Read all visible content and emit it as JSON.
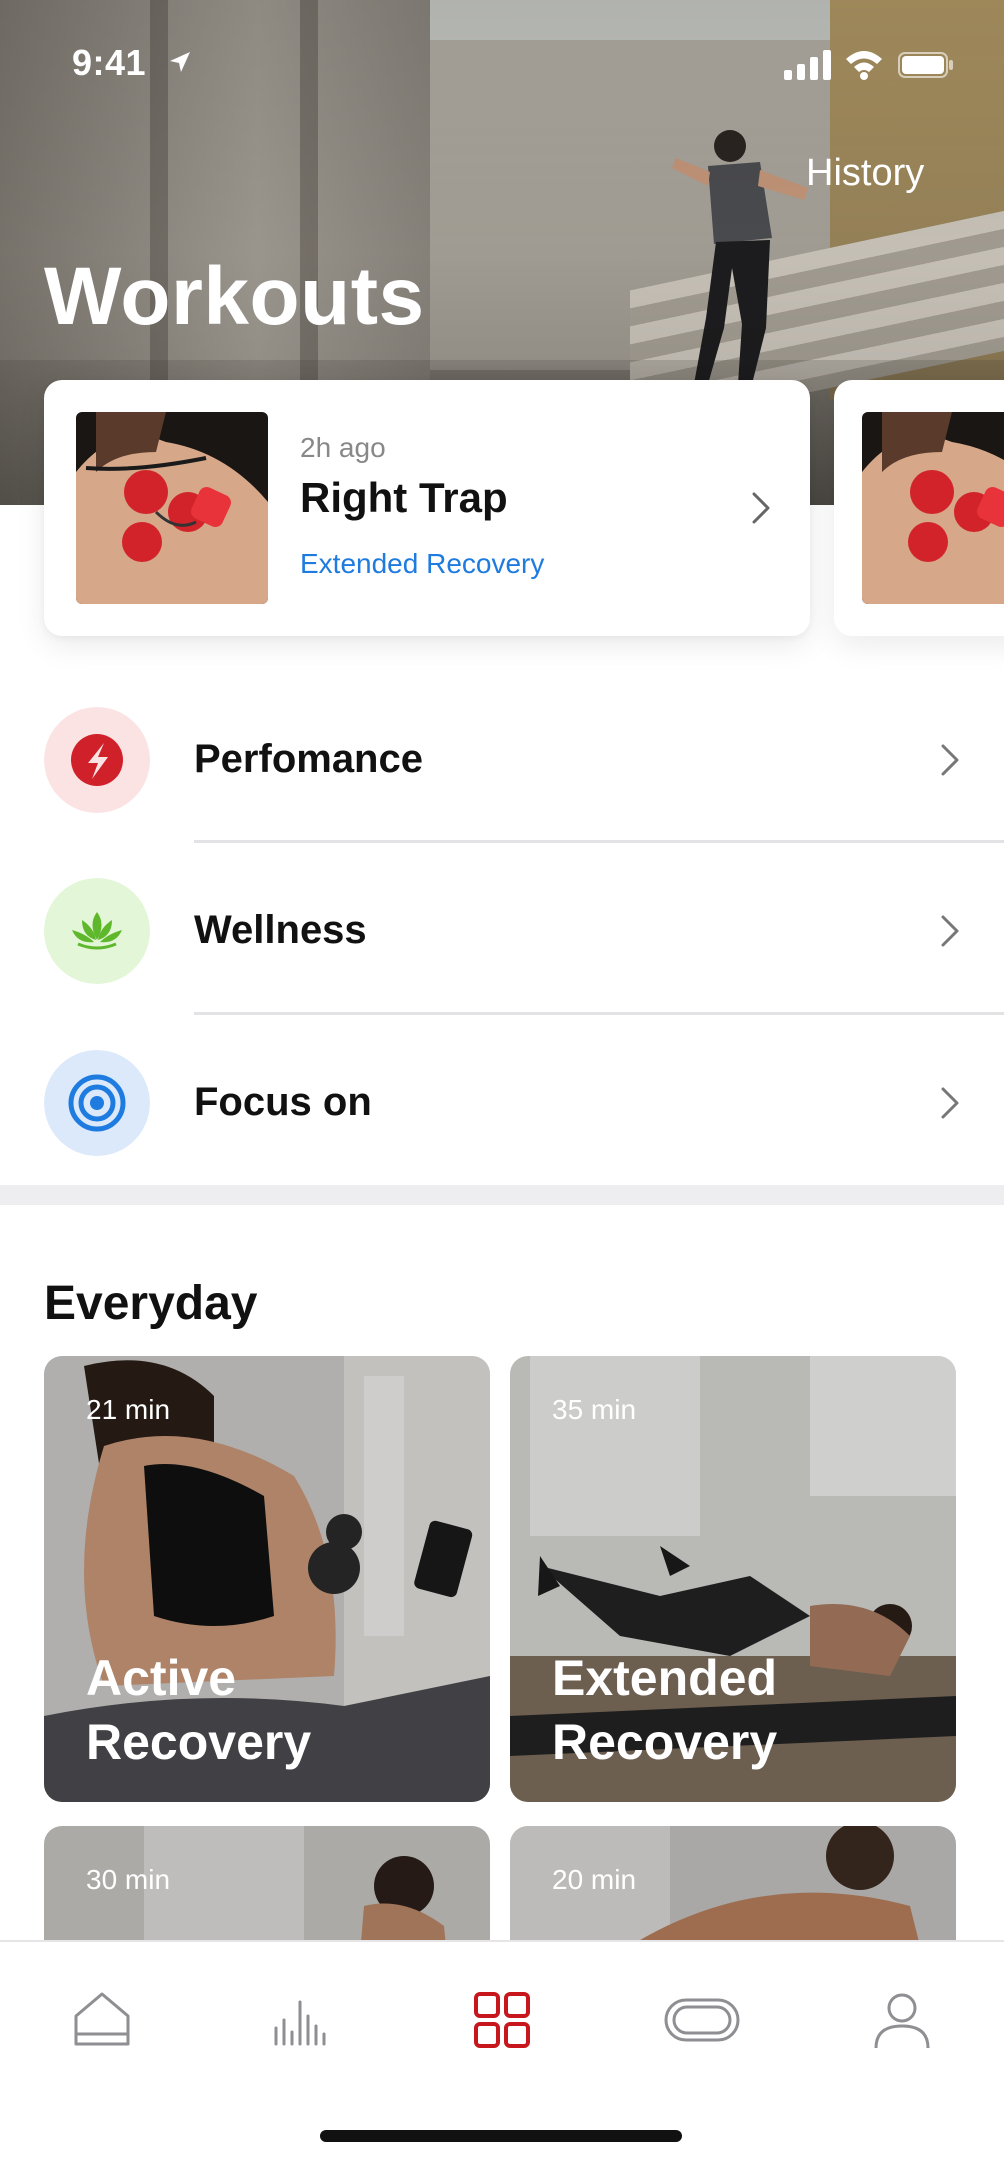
{
  "status_bar": {
    "time": "9:41",
    "icons": [
      "location-arrow-icon",
      "cellular-signal-icon",
      "wifi-icon",
      "battery-icon"
    ]
  },
  "header": {
    "history_label": "History",
    "title": "Workouts"
  },
  "recent_sessions": [
    {
      "time_ago": "2h ago",
      "title": "Right Trap",
      "program": "Extended Recovery",
      "program_color": "#1e7be0"
    }
  ],
  "categories": [
    {
      "label": "Perfomance",
      "icon": "lightning-bolt-icon",
      "icon_color": "#d0202a",
      "bg_color": "#fbe3e3"
    },
    {
      "label": "Wellness",
      "icon": "lotus-icon",
      "icon_color": "#5fb82c",
      "bg_color": "#e3f6d8"
    },
    {
      "label": "Focus on",
      "icon": "target-icon",
      "icon_color": "#1e7be0",
      "bg_color": "#dce9fb"
    }
  ],
  "everyday": {
    "title": "Everyday",
    "workouts": [
      {
        "duration": "21 min",
        "name": "Active Recovery"
      },
      {
        "duration": "35 min",
        "name": "Extended Recovery"
      },
      {
        "duration": "30 min",
        "name": ""
      },
      {
        "duration": "20 min",
        "name": ""
      }
    ]
  },
  "tab_bar": {
    "items": [
      {
        "icon": "home-icon",
        "active": false
      },
      {
        "icon": "stats-icon",
        "active": false
      },
      {
        "icon": "workouts-grid-icon",
        "active": true
      },
      {
        "icon": "device-icon",
        "active": false
      },
      {
        "icon": "profile-icon",
        "active": false
      }
    ],
    "active_color": "#c8161d",
    "inactive_color": "#8e8e93"
  }
}
